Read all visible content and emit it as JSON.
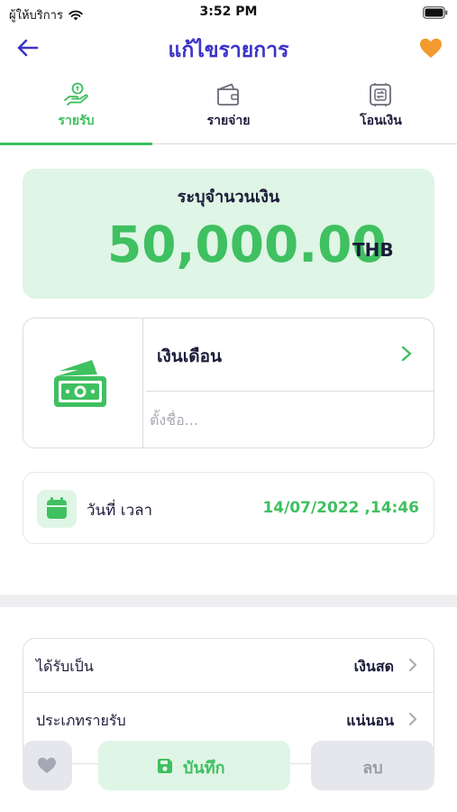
{
  "status_bar": {
    "carrier": "ผู้ให้บริการ",
    "time": "3:52 PM"
  },
  "nav": {
    "title": "แก้ไขรายการ",
    "back_icon": "arrow-left-icon",
    "favorite_icon": "heart-icon"
  },
  "tabs": [
    {
      "label": "รายรับ",
      "icon": "income-icon",
      "active": true
    },
    {
      "label": "รายจ่าย",
      "icon": "wallet-icon",
      "active": false
    },
    {
      "label": "โอนเงิน",
      "icon": "transfer-icon",
      "active": false
    }
  ],
  "amount": {
    "label": "ระบุจำนวนเงิน",
    "value": "50,000.00",
    "currency": "THB"
  },
  "category": {
    "icon": "money-icon",
    "name": "เงินเดือน",
    "name_placeholder": "ตั้งชื่อ..."
  },
  "datetime": {
    "label": "วันที่ เวลา",
    "value": "14/07/2022 ,14:46"
  },
  "details": [
    {
      "label": "ได้รับเป็น",
      "value": "เงินสด"
    },
    {
      "label": "ประเภทรายรับ",
      "value": "แน่นอน"
    }
  ],
  "actions": {
    "save_label": "บันทึก",
    "delete_label": "ลบ"
  },
  "colors": {
    "accent_green": "#3fc061",
    "title_purple": "#3b34c9",
    "favorite_orange": "#f29a2e",
    "mint_background": "#dff5e5"
  }
}
